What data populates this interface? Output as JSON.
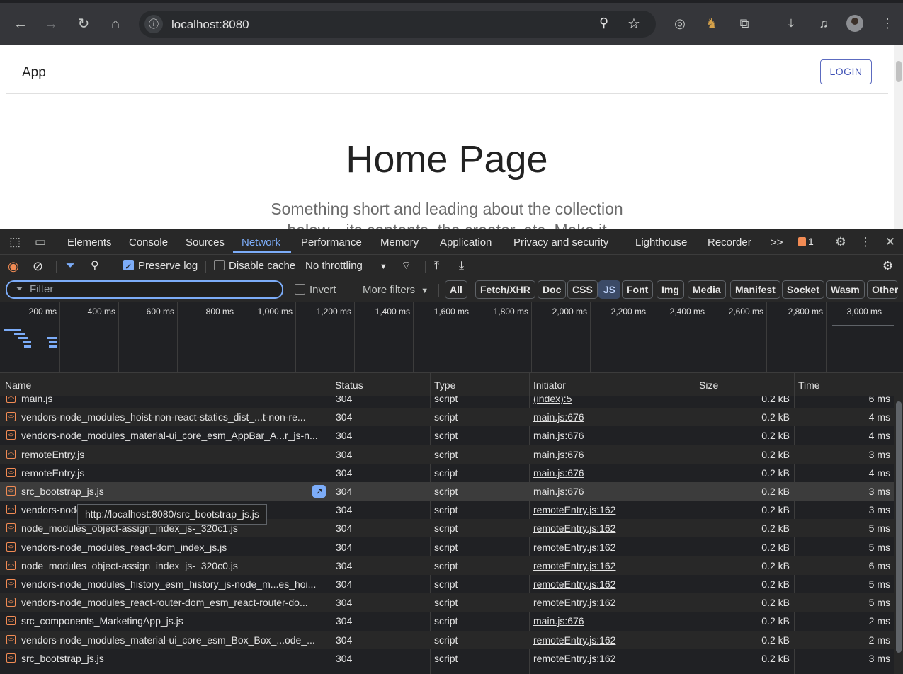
{
  "browser": {
    "url": "localhost:8080",
    "icons": [
      "back-icon",
      "forward-icon",
      "reload-icon",
      "home-icon",
      "site-info-icon",
      "zoom-icon",
      "bookmark-star-icon",
      "extension-target-icon",
      "extension-llama-icon",
      "extensions-puzzle-icon",
      "downloads-icon",
      "media-controls-icon",
      "profile-avatar",
      "chrome-menu-icon"
    ]
  },
  "page": {
    "app_title": "App",
    "login_label": "LOGIN",
    "heading": "Home Page",
    "subtitle": "Something short and leading about the collection below—its contents, the creator, etc. Make it short"
  },
  "devtools": {
    "tabs": [
      "Elements",
      "Console",
      "Sources",
      "Network",
      "Performance",
      "Memory",
      "Application",
      "Privacy and security",
      "Lighthouse",
      "Recorder"
    ],
    "active_tab": "Network",
    "overflow_label": ">>",
    "issues_count": "1",
    "toolbar": {
      "preserve_log": "Preserve log",
      "disable_cache": "Disable cache",
      "throttling": "No throttling"
    },
    "filter": {
      "placeholder": "Filter",
      "invert": "Invert",
      "more_filters": "More filters",
      "types": [
        "All",
        "Fetch/XHR",
        "Doc",
        "CSS",
        "JS",
        "Font",
        "Img",
        "Media",
        "Manifest",
        "Socket",
        "Wasm",
        "Other"
      ],
      "active_type": "JS"
    },
    "timeline_ticks": [
      "200 ms",
      "400 ms",
      "600 ms",
      "800 ms",
      "1,000 ms",
      "1,200 ms",
      "1,400 ms",
      "1,600 ms",
      "1,800 ms",
      "2,000 ms",
      "2,200 ms",
      "2,400 ms",
      "2,600 ms",
      "2,800 ms",
      "3,000 ms"
    ],
    "columns": {
      "name": "Name",
      "status": "Status",
      "type": "Type",
      "initiator": "Initiator",
      "size": "Size",
      "time": "Time"
    },
    "rows": [
      {
        "name": "main.js",
        "status": "304",
        "type": "script",
        "initiator": "(index):5",
        "size": "0.2 kB",
        "time": "6 ms"
      },
      {
        "name": "vendors-node_modules_hoist-non-react-statics_dist_...t-non-re...",
        "status": "304",
        "type": "script",
        "initiator": "main.js:676",
        "size": "0.2 kB",
        "time": "4 ms"
      },
      {
        "name": "vendors-node_modules_material-ui_core_esm_AppBar_A...r_js-n...",
        "status": "304",
        "type": "script",
        "initiator": "main.js:676",
        "size": "0.2 kB",
        "time": "4 ms"
      },
      {
        "name": "remoteEntry.js",
        "status": "304",
        "type": "script",
        "initiator": "main.js:676",
        "size": "0.2 kB",
        "time": "3 ms"
      },
      {
        "name": "remoteEntry.js",
        "status": "304",
        "type": "script",
        "initiator": "main.js:676",
        "size": "0.2 kB",
        "time": "4 ms"
      },
      {
        "name": "src_bootstrap_js.js",
        "status": "304",
        "type": "script",
        "initiator": "main.js:676",
        "size": "0.2 kB",
        "time": "3 ms"
      },
      {
        "name": "vendors-node",
        "status": "304",
        "type": "script",
        "initiator": "remoteEntry.js:162",
        "size": "0.2 kB",
        "time": "3 ms"
      },
      {
        "name": "node_modules_object-assign_index_js-_320c1.js",
        "status": "304",
        "type": "script",
        "initiator": "remoteEntry.js:162",
        "size": "0.2 kB",
        "time": "5 ms"
      },
      {
        "name": "vendors-node_modules_react-dom_index_js.js",
        "status": "304",
        "type": "script",
        "initiator": "remoteEntry.js:162",
        "size": "0.2 kB",
        "time": "5 ms"
      },
      {
        "name": "node_modules_object-assign_index_js-_320c0.js",
        "status": "304",
        "type": "script",
        "initiator": "remoteEntry.js:162",
        "size": "0.2 kB",
        "time": "6 ms"
      },
      {
        "name": "vendors-node_modules_history_esm_history_js-node_m...es_hoi...",
        "status": "304",
        "type": "script",
        "initiator": "remoteEntry.js:162",
        "size": "0.2 kB",
        "time": "5 ms"
      },
      {
        "name": "vendors-node_modules_react-router-dom_esm_react-router-do...",
        "status": "304",
        "type": "script",
        "initiator": "remoteEntry.js:162",
        "size": "0.2 kB",
        "time": "5 ms"
      },
      {
        "name": "src_components_MarketingApp_js.js",
        "status": "304",
        "type": "script",
        "initiator": "main.js:676",
        "size": "0.2 kB",
        "time": "2 ms"
      },
      {
        "name": "vendors-node_modules_material-ui_core_esm_Box_Box_...ode_...",
        "status": "304",
        "type": "script",
        "initiator": "remoteEntry.js:162",
        "size": "0.2 kB",
        "time": "2 ms"
      },
      {
        "name": "src_bootstrap_js.js",
        "status": "304",
        "type": "script",
        "initiator": "remoteEntry.js:162",
        "size": "0.2 kB",
        "time": "3 ms"
      }
    ],
    "tooltip": "http://localhost:8080/src_bootstrap_js.js"
  },
  "colors": {
    "accent": "#7cacf8",
    "devtools_bg": "#202124",
    "issue_badge": "#f28b54"
  }
}
